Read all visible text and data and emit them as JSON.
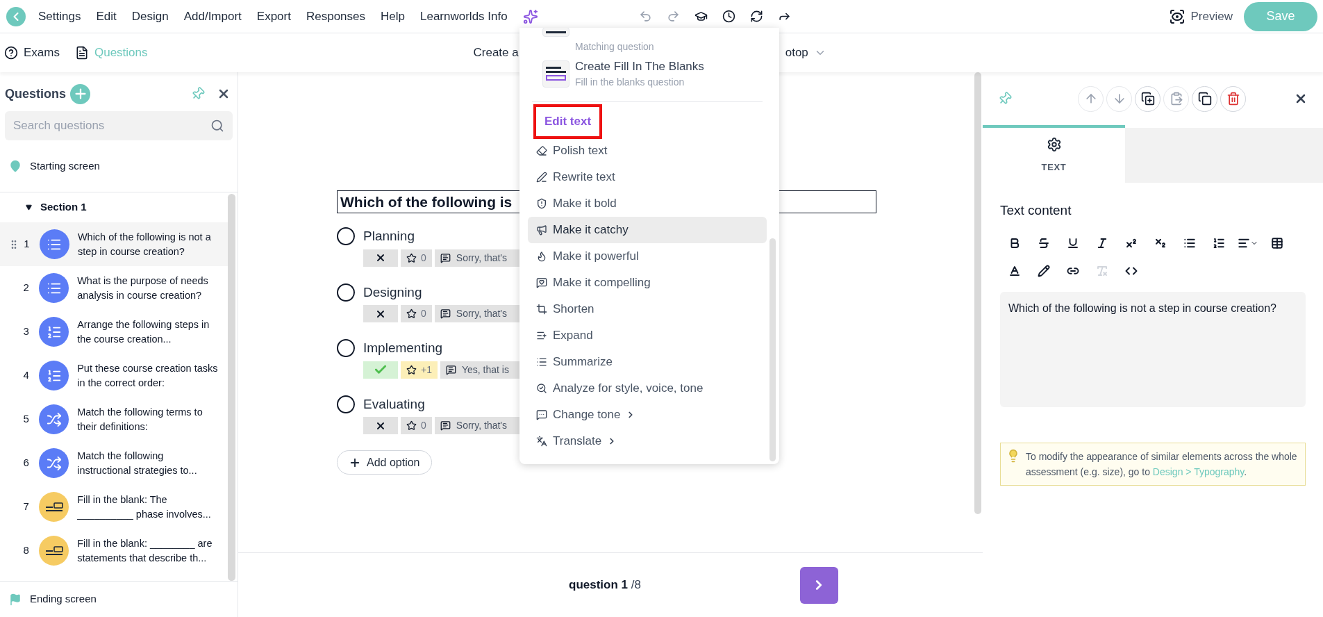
{
  "menubar": {
    "items": [
      "Settings",
      "Edit",
      "Design",
      "Add/Import",
      "Export",
      "Responses",
      "Help",
      "Learnworlds Info"
    ]
  },
  "history": [
    {
      "kind": "undo",
      "disabled": true
    },
    {
      "kind": "redo",
      "disabled": true
    },
    {
      "kind": "course",
      "disabled": false
    },
    {
      "kind": "history",
      "disabled": false
    },
    {
      "kind": "sync",
      "disabled": false
    },
    {
      "kind": "share",
      "disabled": false
    }
  ],
  "preview": "Preview",
  "save": "Save",
  "subnav": {
    "tabs": [
      {
        "label": "Exams",
        "kind": "help",
        "selected": false
      },
      {
        "label": "Questions",
        "kind": "doc",
        "selected": true
      }
    ],
    "title_start": "Create a",
    "title_end": "otop"
  },
  "sidebar": {
    "title": "Questions",
    "search": {
      "placeholder": "Search questions"
    },
    "start": "Starting screen",
    "section": {
      "label": "Section 1",
      "expanded": true
    },
    "questions": [
      {
        "number": "1",
        "kind": "single",
        "text": "Which of the following is not a step in course creation?",
        "selected": true
      },
      {
        "number": "2",
        "kind": "single",
        "text": "What is the purpose of needs analysis in course creation?",
        "selected": false
      },
      {
        "number": "3",
        "kind": "order",
        "text": "Arrange the following steps in the course creation...",
        "selected": false
      },
      {
        "number": "4",
        "kind": "order",
        "text": "Put these course creation tasks in the correct order:",
        "selected": false
      },
      {
        "number": "5",
        "kind": "match",
        "text": "Match the following terms to their definitions:",
        "selected": false
      },
      {
        "number": "6",
        "kind": "match",
        "text": "Match the following instructional strategies to...",
        "selected": false
      },
      {
        "number": "7",
        "kind": "fill",
        "text": "Fill in the blank: The __________ phase involves...",
        "selected": false
      },
      {
        "number": "8",
        "kind": "fill",
        "text": "Fill in the blank: ________ are statements that describe th...",
        "selected": false
      }
    ],
    "end": "Ending screen"
  },
  "question": {
    "title": "Which of the following is",
    "options": [
      {
        "label": "Planning",
        "selected": false,
        "correct": false,
        "points": "0",
        "feedback": "Sorry, that's"
      },
      {
        "label": "Designing",
        "selected": false,
        "correct": false,
        "points": "0",
        "feedback": "Sorry, that's"
      },
      {
        "label": "Implementing",
        "selected": false,
        "correct": true,
        "points": "+1",
        "feedback": "Yes, that is"
      },
      {
        "label": "Evaluating",
        "selected": false,
        "correct": false,
        "points": "0",
        "feedback": "Sorry, that's"
      }
    ],
    "add_option": "Add option"
  },
  "pager": {
    "current": "question 1",
    "total": "/8"
  },
  "ai_menu": {
    "create_items": [
      {
        "kind": "match",
        "subtitle": "Matching question"
      },
      {
        "kind": "fill",
        "title": "Create Fill In The Blanks",
        "subtitle": "Fill in the blanks question"
      }
    ],
    "edit_heading": {
      "label": "Edit text",
      "outlined": true
    },
    "actions": [
      {
        "kind": "polish",
        "label": "Polish text",
        "hovered": false,
        "submenu": false
      },
      {
        "kind": "rewrite",
        "label": "Rewrite text",
        "hovered": false,
        "submenu": false
      },
      {
        "kind": "bold",
        "label": "Make it bold",
        "hovered": false,
        "submenu": false
      },
      {
        "kind": "catchy",
        "label": "Make it catchy",
        "hovered": true,
        "submenu": false
      },
      {
        "kind": "powerful",
        "label": "Make it powerful",
        "hovered": false,
        "submenu": false
      },
      {
        "kind": "compelling",
        "label": "Make it compelling",
        "hovered": false,
        "submenu": false
      },
      {
        "kind": "shorten",
        "label": "Shorten",
        "hovered": false,
        "submenu": false
      },
      {
        "kind": "expand",
        "label": "Expand",
        "hovered": false,
        "submenu": false
      },
      {
        "kind": "summarize",
        "label": "Summarize",
        "hovered": false,
        "submenu": false
      },
      {
        "kind": "analyze",
        "label": "Analyze for style, voice, tone",
        "hovered": false,
        "submenu": false
      },
      {
        "kind": "tone",
        "label": "Change tone",
        "hovered": false,
        "submenu": true
      },
      {
        "kind": "translate",
        "label": "Translate",
        "hovered": false,
        "submenu": true
      }
    ]
  },
  "panel": {
    "tools": [
      {
        "kind": "up",
        "disabled": true
      },
      {
        "kind": "down",
        "disabled": true
      },
      {
        "kind": "copy-style",
        "disabled": false
      },
      {
        "kind": "paste",
        "disabled": true
      },
      {
        "kind": "duplicate",
        "disabled": false
      },
      {
        "kind": "delete",
        "disabled": false
      }
    ],
    "tabs": [
      {
        "label": "TEXT",
        "selected": true
      }
    ],
    "content_label": "Text content",
    "editor_tools": [
      {
        "kind": "bold",
        "disabled": false
      },
      {
        "kind": "strike",
        "disabled": false
      },
      {
        "kind": "underline",
        "disabled": false
      },
      {
        "kind": "italic",
        "disabled": false
      },
      {
        "kind": "sup",
        "disabled": false
      },
      {
        "kind": "sub",
        "disabled": false
      },
      {
        "kind": "bullets",
        "disabled": false
      },
      {
        "kind": "numbers",
        "disabled": false
      },
      {
        "kind": "align",
        "disabled": false
      },
      {
        "kind": "table",
        "disabled": false
      },
      {
        "kind": "color",
        "disabled": false
      },
      {
        "kind": "pen",
        "disabled": false
      },
      {
        "kind": "link",
        "disabled": false
      },
      {
        "kind": "clear",
        "disabled": true
      },
      {
        "kind": "code",
        "disabled": false
      }
    ],
    "editor_text": "Which of the following is not a step in course creation?",
    "tip": {
      "text": "To modify the appearance of similar elements across the whole assessment (e.g. size), go to ",
      "link": "Design > Typography",
      "end": "."
    }
  }
}
